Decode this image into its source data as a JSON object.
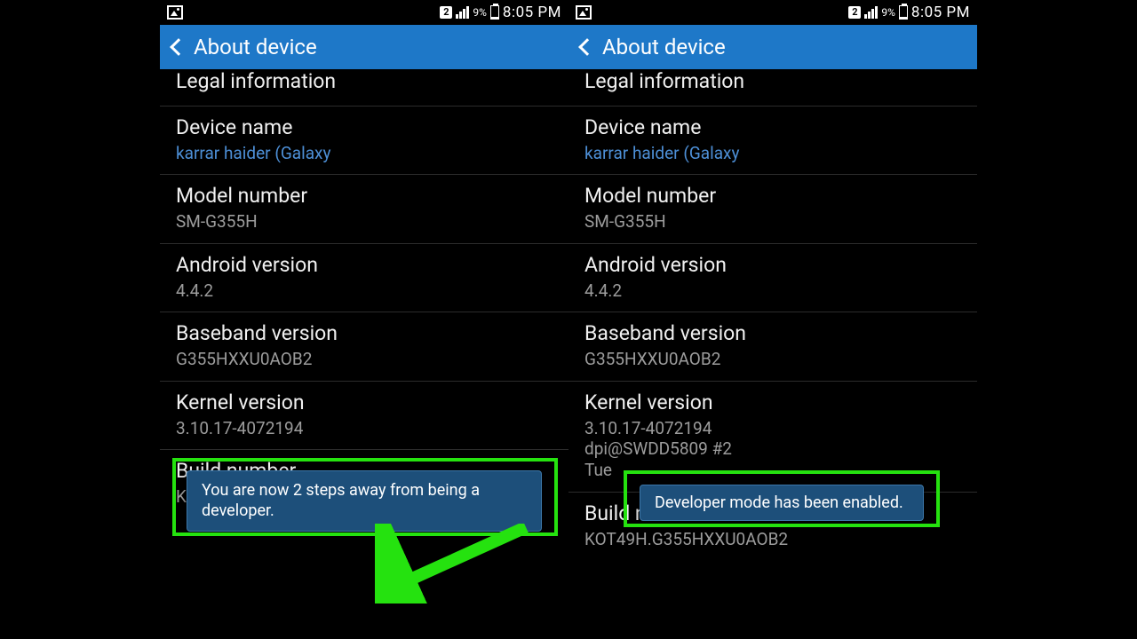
{
  "statusbar": {
    "sim": "2",
    "battery_pct": "9%",
    "clock": "8:05 PM"
  },
  "header": {
    "title": "About device"
  },
  "rows": {
    "legal": {
      "label": "Legal information"
    },
    "device_name": {
      "label": "Device name",
      "value": "karrar haider (Galaxy"
    },
    "model": {
      "label": "Model number",
      "value": "SM-G355H"
    },
    "android": {
      "label": "Android version",
      "value": "4.4.2"
    },
    "baseband": {
      "label": "Baseband version",
      "value": "G355HXXU0AOB2"
    },
    "kernel_left": {
      "label": "Kernel version",
      "value": "3.10.17-4072194"
    },
    "kernel_right": {
      "label": "Kernel version",
      "value": "3.10.17-4072194\ndpi@SWDD5809 #2\nTue"
    },
    "build": {
      "label": "Build number",
      "value": "KOT49H.G355HXXU0AOB2"
    }
  },
  "toasts": {
    "left": "You are now 2 steps away from being a developer.",
    "right": "Developer mode has been enabled."
  }
}
